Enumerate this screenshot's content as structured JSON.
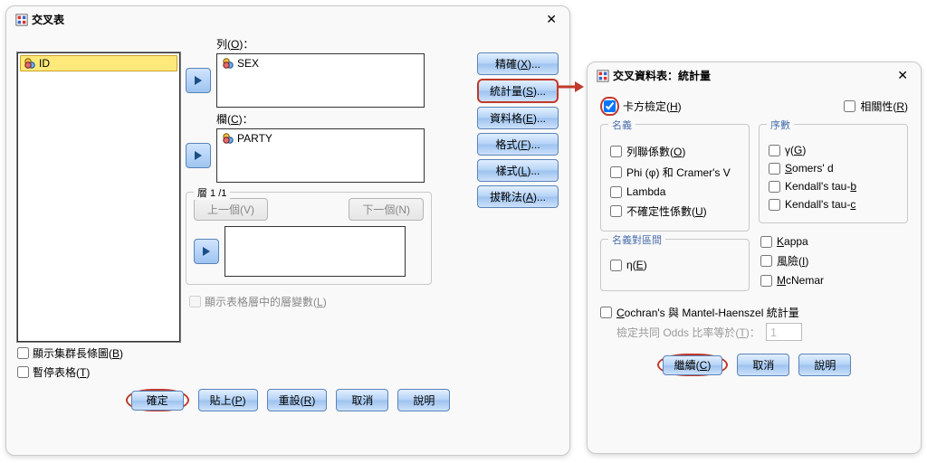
{
  "crosstabs": {
    "title": "交叉表",
    "left_var": "ID",
    "row_label_pre": "列(",
    "row_mn": "O",
    "row_label_post": ")：",
    "row_var": "SEX",
    "col_label_pre": "欄(",
    "col_mn": "C",
    "col_label_post": ")：",
    "col_var": "PARTY",
    "layer_legend": "層 1 /1",
    "prev_label": "上一個(V)",
    "next_label": "下一個(N)",
    "layer_note_pre": "顯示表格層中的層變數(",
    "layer_note_mn": "L",
    "layer_note_post": ")",
    "chk_bar_pre": "顯示集群長條圖(",
    "chk_bar_mn": "B",
    "chk_bar_post": ")",
    "chk_suppress_pre": "暫停表格(",
    "chk_suppress_mn": "T",
    "chk_suppress_post": ")",
    "side": {
      "exact_pre": "精確(",
      "exact_mn": "X",
      "exact_post": ")...",
      "stats_pre": "統計量(",
      "stats_mn": "S",
      "stats_post": ")...",
      "cells_pre": "資料格(",
      "cells_mn": "E",
      "cells_post": ")...",
      "format_pre": "格式(",
      "format_mn": "F",
      "format_post": ")...",
      "style_pre": "樣式(",
      "style_mn": "L",
      "style_post": ")...",
      "boot_pre": "拔靴法(",
      "boot_mn": "A",
      "boot_post": ")..."
    },
    "buttons": {
      "ok": "確定",
      "paste_pre": "貼上(",
      "paste_mn": "P",
      "paste_post": ")",
      "reset_pre": "重設(",
      "reset_mn": "R",
      "reset_post": ")",
      "cancel": "取消",
      "help": "說明"
    }
  },
  "stats": {
    "title": "交叉資料表：統計量",
    "chk_chi_pre": "卡方檢定(",
    "chk_chi_mn": "H",
    "chk_chi_post": ")",
    "chk_corr_pre": "相關性(",
    "chk_corr_mn": "R",
    "chk_corr_post": ")",
    "nominal_legend": "名義",
    "ordinal_legend": "序數",
    "interval_legend": "名義對區間",
    "nominal": {
      "cc_pre": "列聯係數(",
      "cc_mn": "O",
      "cc_post": ")",
      "phi": "Phi (φ) 和 Cramer's V",
      "lambda": "Lambda",
      "uncert_pre": "不確定性係數(",
      "uncert_mn": "U",
      "uncert_post": ")"
    },
    "ordinal": {
      "gamma_pre": "γ(",
      "gamma_mn": "G",
      "gamma_post": ")",
      "somers_pre": "S",
      "somers_mid": "omers' d",
      "taub_pre": "Kendall's tau-",
      "taub_mn": "b",
      "tauc_pre": "Kendall's tau-",
      "tauc_mn": "c"
    },
    "interval": {
      "eta_pre": "η(",
      "eta_mn": "E",
      "eta_post": ")"
    },
    "right": {
      "kappa_pre": "K",
      "kappa_mid": "appa",
      "risk_pre": "風險(",
      "risk_mn": "I",
      "risk_post": ")",
      "mcnemar_pre": "M",
      "mcnemar_mid": "cNemar"
    },
    "cmh_pre": "C",
    "cmh_mid": "ochran's 與 Mantel-Haenszel 統計量",
    "odds_label_pre": "檢定共同 Odds 比率等於(",
    "odds_label_mn": "T",
    "odds_label_post": ")：",
    "odds_value": "1",
    "buttons": {
      "continue_pre": "繼續(",
      "continue_mn": "C",
      "continue_post": ")",
      "cancel": "取消",
      "help": "說明"
    }
  }
}
